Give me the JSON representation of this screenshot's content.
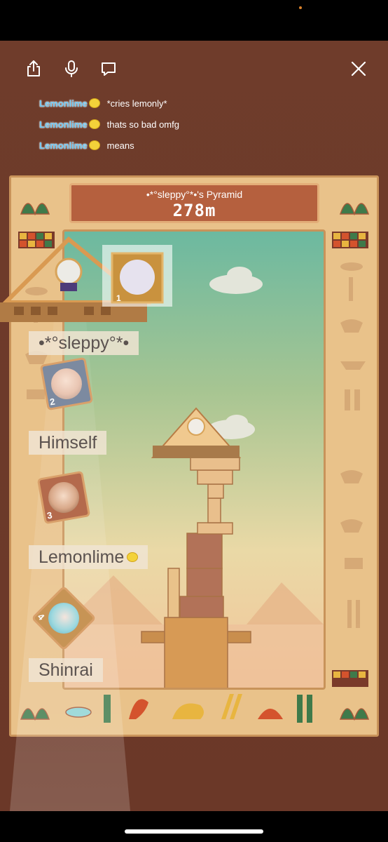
{
  "toolbar": {
    "share_icon": "share-icon",
    "mic_icon": "microphone-icon",
    "chat_icon": "chat-bubble-icon",
    "close_icon": "close-icon"
  },
  "chat": [
    {
      "user": "Lemonlime",
      "message": "*cries lemonly*"
    },
    {
      "user": "Lemonlime",
      "message": "thats so bad omfg"
    },
    {
      "user": "Lemonlime",
      "message": "means"
    }
  ],
  "game": {
    "pyramid_name": "•*°sleppy°*•'s Pyramid",
    "height": "278m"
  },
  "ranking": [
    {
      "rank": "1",
      "name": "•*°sleppy°*•"
    },
    {
      "rank": "2",
      "name": "Himself"
    },
    {
      "rank": "3",
      "name": "Lemonlime"
    },
    {
      "rank": "4",
      "name": "Shinrai"
    }
  ],
  "colors": {
    "background": "#6e3b2a",
    "board": "#e9c28a",
    "title_plate": "#b5603e",
    "chat_name": "#6ec5f0"
  }
}
